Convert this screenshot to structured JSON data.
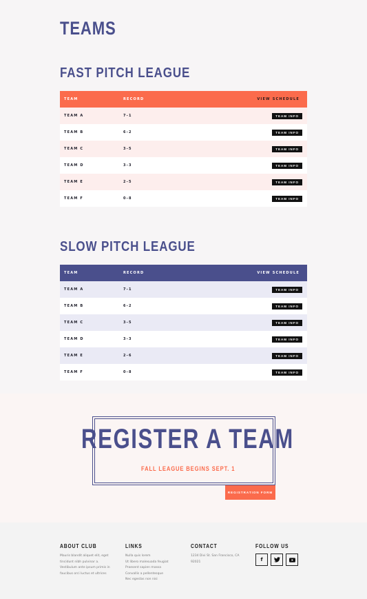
{
  "page": {
    "title": "TEAMS"
  },
  "fast": {
    "title": "FAST PITCH LEAGUE",
    "headers": {
      "team": "TEAM",
      "record": "RECORD",
      "schedule": "VIEW SCHEDULE"
    },
    "rows": [
      {
        "team": "TEAM A",
        "record": "7-1",
        "action": "TEAM INFO"
      },
      {
        "team": "TEAM B",
        "record": "6-2",
        "action": "TEAM INFO"
      },
      {
        "team": "TEAM C",
        "record": "3-5",
        "action": "TEAM INFO"
      },
      {
        "team": "TEAM D",
        "record": "3-3",
        "action": "TEAM INFO"
      },
      {
        "team": "TEAM E",
        "record": "2-5",
        "action": "TEAM INFO"
      },
      {
        "team": "TEAM F",
        "record": "0-8",
        "action": "TEAM INFO"
      }
    ]
  },
  "slow": {
    "title": "SLOW PITCH LEAGUE",
    "headers": {
      "team": "TEAM",
      "record": "RECORD",
      "schedule": "VIEW SCHEDULE"
    },
    "rows": [
      {
        "team": "TEAM A",
        "record": "7-1",
        "action": "TEAM INFO"
      },
      {
        "team": "TEAM B",
        "record": "6-2",
        "action": "TEAM INFO"
      },
      {
        "team": "TEAM C",
        "record": "3-5",
        "action": "TEAM INFO"
      },
      {
        "team": "TEAM D",
        "record": "3-3",
        "action": "TEAM INFO"
      },
      {
        "team": "TEAM E",
        "record": "2-6",
        "action": "TEAM INFO"
      },
      {
        "team": "TEAM F",
        "record": "0-8",
        "action": "TEAM INFO"
      }
    ]
  },
  "register": {
    "title": "REGISTER A TEAM",
    "subtitle": "FALL LEAGUE BEGINS SEPT. 1",
    "button": "REGISTRATION FORM"
  },
  "footer": {
    "about": {
      "heading": "ABOUT CLUB",
      "lines": [
        "Mauris blandit aliquet elit, eget",
        "tincidunt nibh pulvinar a.",
        "Vestibulum ante ipsum primis in",
        "faucibus orci luctus et ultrices"
      ]
    },
    "links": {
      "heading": "LINKS",
      "items": [
        "Nulla quis lorem",
        "Ut libero malesuada feugiat",
        "Praesent sapien massa",
        "Convallis a pellentesque",
        "Nec egestas non nisi"
      ]
    },
    "contact": {
      "heading": "CONTACT",
      "lines": [
        "1234 Divi St. San Francisco, CA",
        "92021"
      ]
    },
    "follow": {
      "heading": "FOLLOW US",
      "icons": [
        "facebook-icon",
        "twitter-icon",
        "youtube-icon"
      ]
    }
  },
  "colors": {
    "accent": "#fb6b4c",
    "brand": "#4a4f8c"
  }
}
